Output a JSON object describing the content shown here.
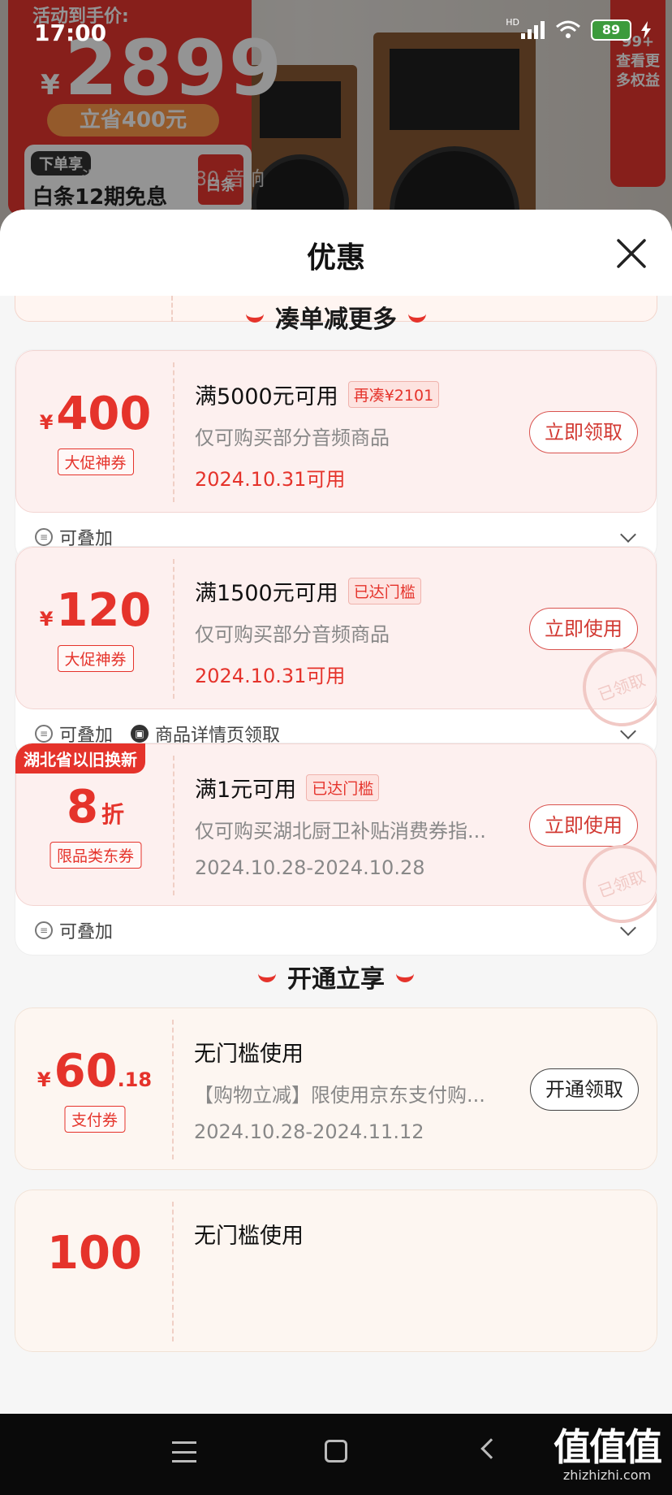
{
  "status_bar": {
    "time": "17:00",
    "network": "HD",
    "battery": "89"
  },
  "background": {
    "promo_top": "活动到手价:",
    "promo_currency": "¥",
    "promo_price": "2899",
    "promo_save": "立省400元",
    "baitiao_tag": "下单享",
    "baitiao_text": "白条12期免息",
    "baitiao_logo": "白条",
    "product_tabs": "漫步者a80    a80    音响",
    "side_badge": "查看更多权益",
    "side_badge_count": "99+"
  },
  "sheet": {
    "title": "优惠"
  },
  "sections": [
    {
      "title": "凑单减更多"
    },
    {
      "title": "开通立享"
    }
  ],
  "coupons": [
    {
      "currency": "¥",
      "amount": "400",
      "type": "大促神券",
      "condition": "满5000元可用",
      "badge": "再凑¥2101",
      "scope": "仅可购买部分音频商品",
      "date": "2024.10.31可用",
      "action": "立即领取",
      "footer": [
        "可叠加"
      ]
    },
    {
      "currency": "¥",
      "amount": "120",
      "type": "大促神券",
      "condition": "满1500元可用",
      "badge": "已达门槛",
      "scope": "仅可购买部分音频商品",
      "date": "2024.10.31可用",
      "action": "立即使用",
      "stamp": "已领取",
      "footer": [
        "可叠加",
        "商品详情页领取"
      ]
    },
    {
      "corner_tag": "湖北省以旧换新",
      "amount": "8",
      "unit": "折",
      "type": "限品类东券",
      "condition": "满1元可用",
      "badge": "已达门槛",
      "scope": "仅可购买湖北厨卫补贴消费券指...",
      "date": "2024.10.28-2024.10.28",
      "action": "立即使用",
      "stamp": "已领取",
      "footer": [
        "可叠加"
      ]
    },
    {
      "currency": "¥",
      "amount": "60",
      "decimal": ".18",
      "type": "支付券",
      "condition": "无门槛使用",
      "scope": "【购物立减】限使用京东支付购...",
      "date": "2024.10.28-2024.11.12",
      "action": "开通领取"
    },
    {
      "amount": "100",
      "condition": "无门槛使用"
    }
  ],
  "watermark": {
    "big": "值值值",
    "small": "zhizhizhi.com"
  },
  "colors": {
    "accent": "#e5332b",
    "coupon_bg": "#fdf0ef",
    "sheet_bg": "#f6f6f6"
  },
  "icons": [
    "close-icon",
    "stack-icon",
    "coupon-source-icon",
    "chevron-down-icon"
  ]
}
